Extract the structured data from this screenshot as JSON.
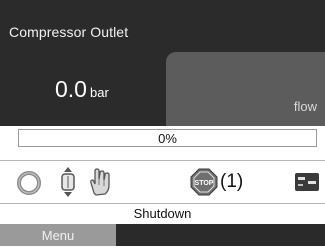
{
  "header": {
    "title": "Compressor Outlet"
  },
  "reading": {
    "value": "0.0",
    "unit": "bar"
  },
  "flow": {
    "label": "flow"
  },
  "progress": {
    "text": "0%",
    "fraction": 0.0
  },
  "icons": {
    "ring": "ring-icon",
    "stepper": "stepper-icon",
    "hand": "hand-icon",
    "stop": "stop-icon",
    "stop_text": "STOP",
    "stop_count": "(1)",
    "panel": "panel-icon"
  },
  "status": {
    "text": "Shutdown"
  },
  "menu": {
    "label": "Menu"
  },
  "colors": {
    "panel_bg": "#2b2b2b",
    "flow_bg": "#5c5c5c",
    "menu_bg": "#9a9a9a",
    "stop_red": "#7a7a7a"
  }
}
